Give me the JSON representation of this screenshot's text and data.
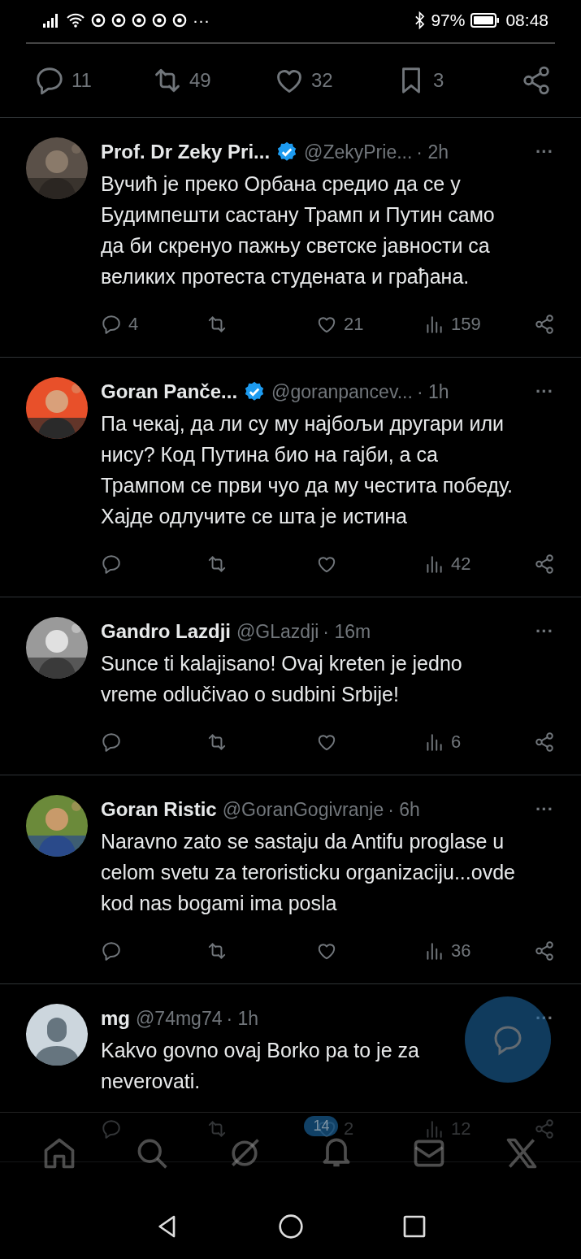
{
  "status_bar": {
    "more": "···",
    "battery_text": "97%",
    "time": "08:48"
  },
  "top_actions": {
    "replies": "11",
    "reposts": "49",
    "likes": "32",
    "bookmarks": "3"
  },
  "replies": [
    {
      "name": "Prof. Dr Zeky Pri...",
      "verified": true,
      "handle": "@ZekyPrie...",
      "time": "· 2h",
      "more": "···",
      "text": "Вучић је преко Орбана средио да се у Будимпешти састану Трамп и Путин само да би скренуо пажњу светске јавности са великих протеста студената и грађана.",
      "replies": "4",
      "likes": "21",
      "views": "159"
    },
    {
      "name": "Goran Panče...",
      "verified": true,
      "handle": "@goranpancev...",
      "time": "· 1h",
      "more": "···",
      "text": "Па чекај, да ли су му најбољи другари или нису? Код Путина био на гајби, а са Трампом се први чуо да му честита победу. Хајде одлучите се шта је истина",
      "views": "42"
    },
    {
      "name": "Gandro Lazdji",
      "verified": false,
      "handle": "@GLazdji",
      "time": "· 16m",
      "more": "···",
      "text": "Sunce ti kalajisano! Ovaj kreten je jedno vreme odlučivao o sudbini Srbije!",
      "views": "6"
    },
    {
      "name": "Goran Ristic",
      "verified": false,
      "handle": "@GoranGogivranje",
      "time": "· 6h",
      "more": "···",
      "text": "Naravno zato se sastaju da Antifu proglase u celom svetu za teroristicku organizaciju...ovde kod nas bogami ima posla",
      "views": "36"
    },
    {
      "avatar": {
        "kind": "default"
      },
      "name": "mg",
      "verified": false,
      "handle": "@74mg74",
      "time": "· 1h",
      "more": "···",
      "text": "Kakvo govno ovaj Borko pa to je za neverovati.",
      "likes": "2",
      "views": "12"
    }
  ],
  "bottom_nav": {
    "notifications_badge": "14"
  }
}
